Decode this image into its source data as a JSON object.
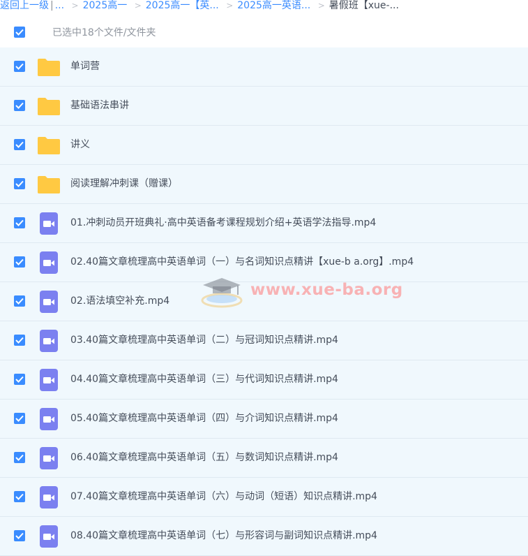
{
  "breadcrumb": {
    "back": "返回上一级",
    "pipe": "|",
    "ellipsis": "...",
    "items": [
      "2025高一",
      "2025高一【英...",
      "2025高一英语...",
      "暑假班【xue-..."
    ],
    "separator": ">"
  },
  "selection": {
    "text": "已选中18个文件/文件夹",
    "checked": true
  },
  "files": [
    {
      "name": "单词营",
      "type": "folder"
    },
    {
      "name": "基础语法串讲",
      "type": "folder"
    },
    {
      "name": "讲义",
      "type": "folder"
    },
    {
      "name": "阅读理解冲刺课（赠课）",
      "type": "folder"
    },
    {
      "name": "01.冲刺动员开班典礼·高中英语备考课程规划介绍+英语学法指导.mp4",
      "type": "video"
    },
    {
      "name": "02.40篇文章梳理高中英语单词（一）与名词知识点精讲【xue-b a.org】.mp4",
      "type": "video"
    },
    {
      "name": "02.语法填空补充.mp4",
      "type": "video"
    },
    {
      "name": "03.40篇文章梳理高中英语单词（二）与冠词知识点精讲.mp4",
      "type": "video"
    },
    {
      "name": "04.40篇文章梳理高中英语单词（三）与代词知识点精讲.mp4",
      "type": "video"
    },
    {
      "name": "05.40篇文章梳理高中英语单词（四）与介词知识点精讲.mp4",
      "type": "video"
    },
    {
      "name": "06.40篇文章梳理高中英语单词（五）与数词知识点精讲.mp4",
      "type": "video"
    },
    {
      "name": "07.40篇文章梳理高中英语单词（六）与动词（短语）知识点精讲.mp4",
      "type": "video"
    },
    {
      "name": "08.40篇文章梳理高中英语单词（七）与形容词与副词知识点精讲.mp4",
      "type": "video"
    }
  ],
  "watermark": {
    "text": "www.xue-ba.org"
  },
  "colors": {
    "accent": "#3a8cff",
    "row_bg": "#f0f8fd",
    "folder": "#ffc943",
    "video": "#7b80f0"
  }
}
